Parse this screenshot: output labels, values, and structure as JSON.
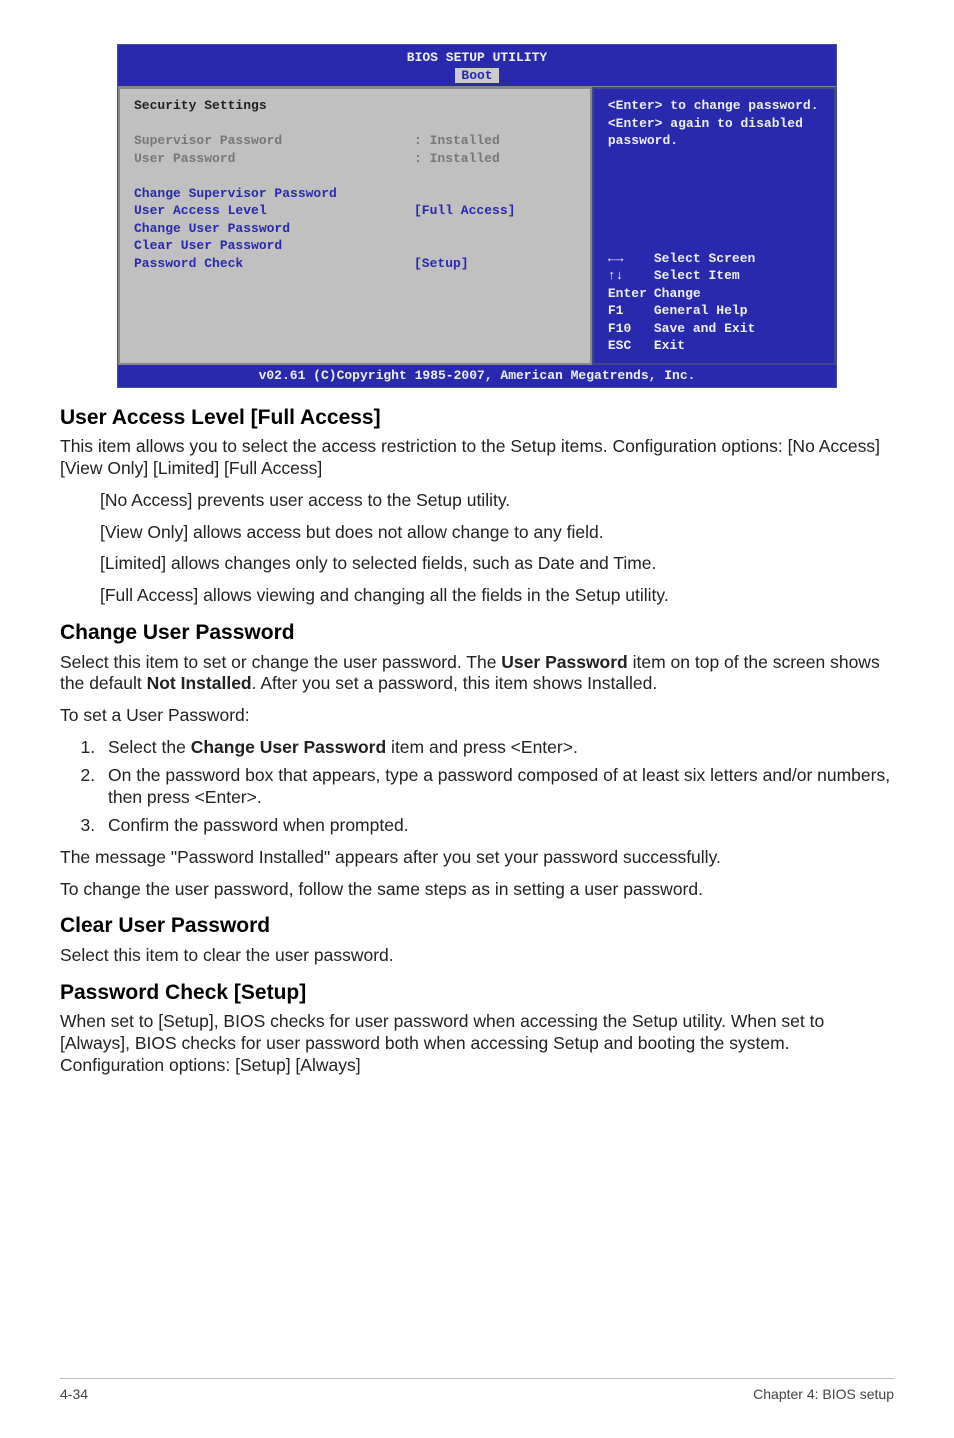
{
  "bios": {
    "title": "BIOS SETUP UTILITY",
    "tab_active": "Boot",
    "left": {
      "section_title": "Security Settings",
      "supervisor_pw_label": "Supervisor Password",
      "supervisor_pw_value": ": Installed",
      "user_pw_label": "User Password",
      "user_pw_value": ": Installed",
      "item_change_supervisor": "Change Supervisor Password",
      "item_user_access_level": "User Access Level",
      "item_user_access_value": "[Full Access]",
      "item_change_user_pw": "Change User Password",
      "item_clear_user_pw": "Clear User Password",
      "item_pw_check": "Password Check",
      "item_pw_check_value": "[Setup]"
    },
    "right": {
      "help_line1": "<Enter> to change password.",
      "help_line2": "<Enter> again to disabled password.",
      "nav_screen_key": "←→",
      "nav_screen": "Select Screen",
      "nav_item_key": "↑↓",
      "nav_item": "Select Item",
      "nav_change_key": "Enter",
      "nav_change": "Change",
      "nav_help_key": "F1",
      "nav_help": "General Help",
      "nav_save_key": "F10",
      "nav_save": "Save and Exit",
      "nav_exit_key": "ESC",
      "nav_exit": "Exit"
    },
    "footer": "v02.61 (C)Copyright 1985-2007, American Megatrends, Inc."
  },
  "doc": {
    "h_user_access": "User Access Level [Full Access]",
    "p_user_access1": "This item allows you to select the access restriction to the Setup items. Configuration options: [No Access] [View Only] [Limited] [Full Access]",
    "p_no_access": "[No Access] prevents user access to the Setup utility.",
    "p_view_only": "[View Only] allows access but does not allow change to any field.",
    "p_limited": "[Limited] allows changes only to selected fields, such as Date and Time.",
    "p_full_access": "[Full Access] allows viewing and changing all the fields in the Setup utility.",
    "h_change_user_pw": "Change User Password",
    "p_change_user_1a": "Select this item to set or change the user password. The ",
    "p_change_user_1b": "User Password",
    "p_change_user_1c": " item on top of the screen shows the default ",
    "p_change_user_1d": "Not Installed",
    "p_change_user_1e": ". After you set a password, this item shows Installed.",
    "p_to_set": "To set a User Password:",
    "step1a": "Select the ",
    "step1b": "Change User Password",
    "step1c": " item and press <Enter>.",
    "step2": "On the password box that appears, type a password composed of at least six letters and/or numbers, then press <Enter>.",
    "step3": "Confirm the password when prompted.",
    "p_msg_installed": "The message \"Password Installed\" appears after you set your password successfully.",
    "p_change_steps": "To change the user password, follow the same steps as in setting a user password.",
    "h_clear_user_pw": "Clear User Password",
    "p_clear_user_pw": "Select this item to clear the user password.",
    "h_pw_check": "Password Check [Setup]",
    "p_pw_check": "When set to [Setup], BIOS checks for user password when accessing the Setup utility. When set to [Always], BIOS checks for user password both when accessing Setup and booting the system. Configuration options: [Setup] [Always]"
  },
  "footer": {
    "page": "4-34",
    "chapter": "Chapter 4: BIOS setup"
  }
}
